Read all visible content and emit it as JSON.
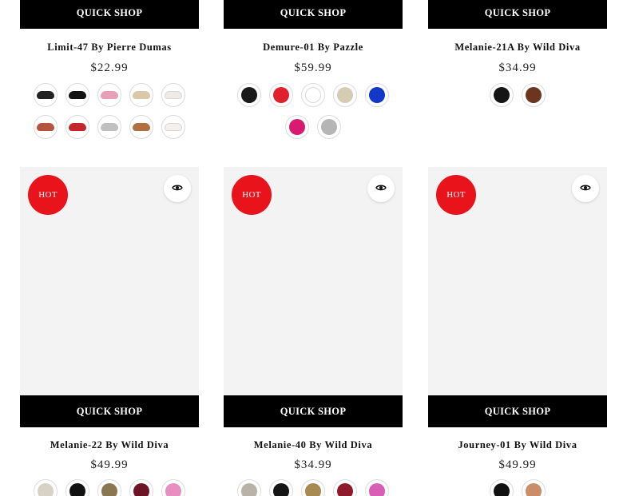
{
  "row1": [
    {
      "quick_shop": "QUICK SHOP",
      "title": "Limit-47 By Pierre Dumas",
      "price": "$22.99",
      "swatches": [
        {
          "color": "#222222",
          "kind": "sandal"
        },
        {
          "color": "#111111",
          "kind": "sandal"
        },
        {
          "color": "#e8a0b8",
          "kind": "sandal"
        },
        {
          "color": "#d9c9a8",
          "kind": "sandal"
        },
        {
          "color": "#eeeae4",
          "kind": "sandal"
        },
        {
          "color": "#b5543f",
          "kind": "sandal"
        },
        {
          "color": "#c1272d",
          "kind": "sandal"
        },
        {
          "color": "#c0c0c0",
          "kind": "sandal"
        },
        {
          "color": "#b07040",
          "kind": "sandal"
        },
        {
          "color": "#f4f1ec",
          "kind": "sandal"
        }
      ]
    },
    {
      "quick_shop": "QUICK SHOP",
      "title": "Demure-01 By Pazzle",
      "price": "$59.99",
      "swatches": [
        {
          "color": "#1a1a1a",
          "kind": "fur"
        },
        {
          "color": "#e0202b",
          "kind": "fur"
        },
        {
          "color": "#ffffff",
          "kind": "fur"
        },
        {
          "color": "#d6ccb4",
          "kind": "fur"
        },
        {
          "color": "#1238c8",
          "kind": "fur"
        },
        {
          "color": "#d81b70",
          "kind": "fur"
        },
        {
          "color": "#b5b5b5",
          "kind": "fur"
        }
      ]
    },
    {
      "quick_shop": "QUICK SHOP",
      "title": "Melanie-21A By Wild Diva",
      "price": "$34.99",
      "swatches": [
        {
          "color": "#151515",
          "kind": "boot"
        },
        {
          "color": "#6b3520",
          "kind": "boot"
        }
      ]
    }
  ],
  "row2": [
    {
      "badge": "HOT",
      "quick_shop": "QUICK SHOP",
      "title": "Melanie-22 By Wild Diva",
      "price": "$49.99",
      "swatches": [
        {
          "color": "#d8d2c6",
          "kind": "boot"
        },
        {
          "color": "#111111",
          "kind": "boot"
        },
        {
          "color": "#8a7650",
          "kind": "boot"
        },
        {
          "color": "#6d1426",
          "kind": "boot"
        },
        {
          "color": "#e78fc0",
          "kind": "boot"
        }
      ]
    },
    {
      "badge": "HOT",
      "quick_shop": "QUICK SHOP",
      "title": "Melanie-40 By Wild Diva",
      "price": "$34.99",
      "swatches": [
        {
          "color": "#b9b2a8",
          "kind": "boot"
        },
        {
          "color": "#151515",
          "kind": "boot"
        },
        {
          "color": "#a88a50",
          "kind": "boot"
        },
        {
          "color": "#8e1a2a",
          "kind": "boot"
        },
        {
          "color": "#d85fb5",
          "kind": "boot"
        }
      ]
    },
    {
      "badge": "HOT",
      "quick_shop": "QUICK SHOP",
      "title": "Journey-01 By Wild Diva",
      "price": "$49.99",
      "swatches": [
        {
          "color": "#111111",
          "kind": "boot"
        },
        {
          "color": "#c98e68",
          "kind": "boot"
        }
      ]
    }
  ],
  "icons": {
    "quick_view": "eye-icon"
  }
}
